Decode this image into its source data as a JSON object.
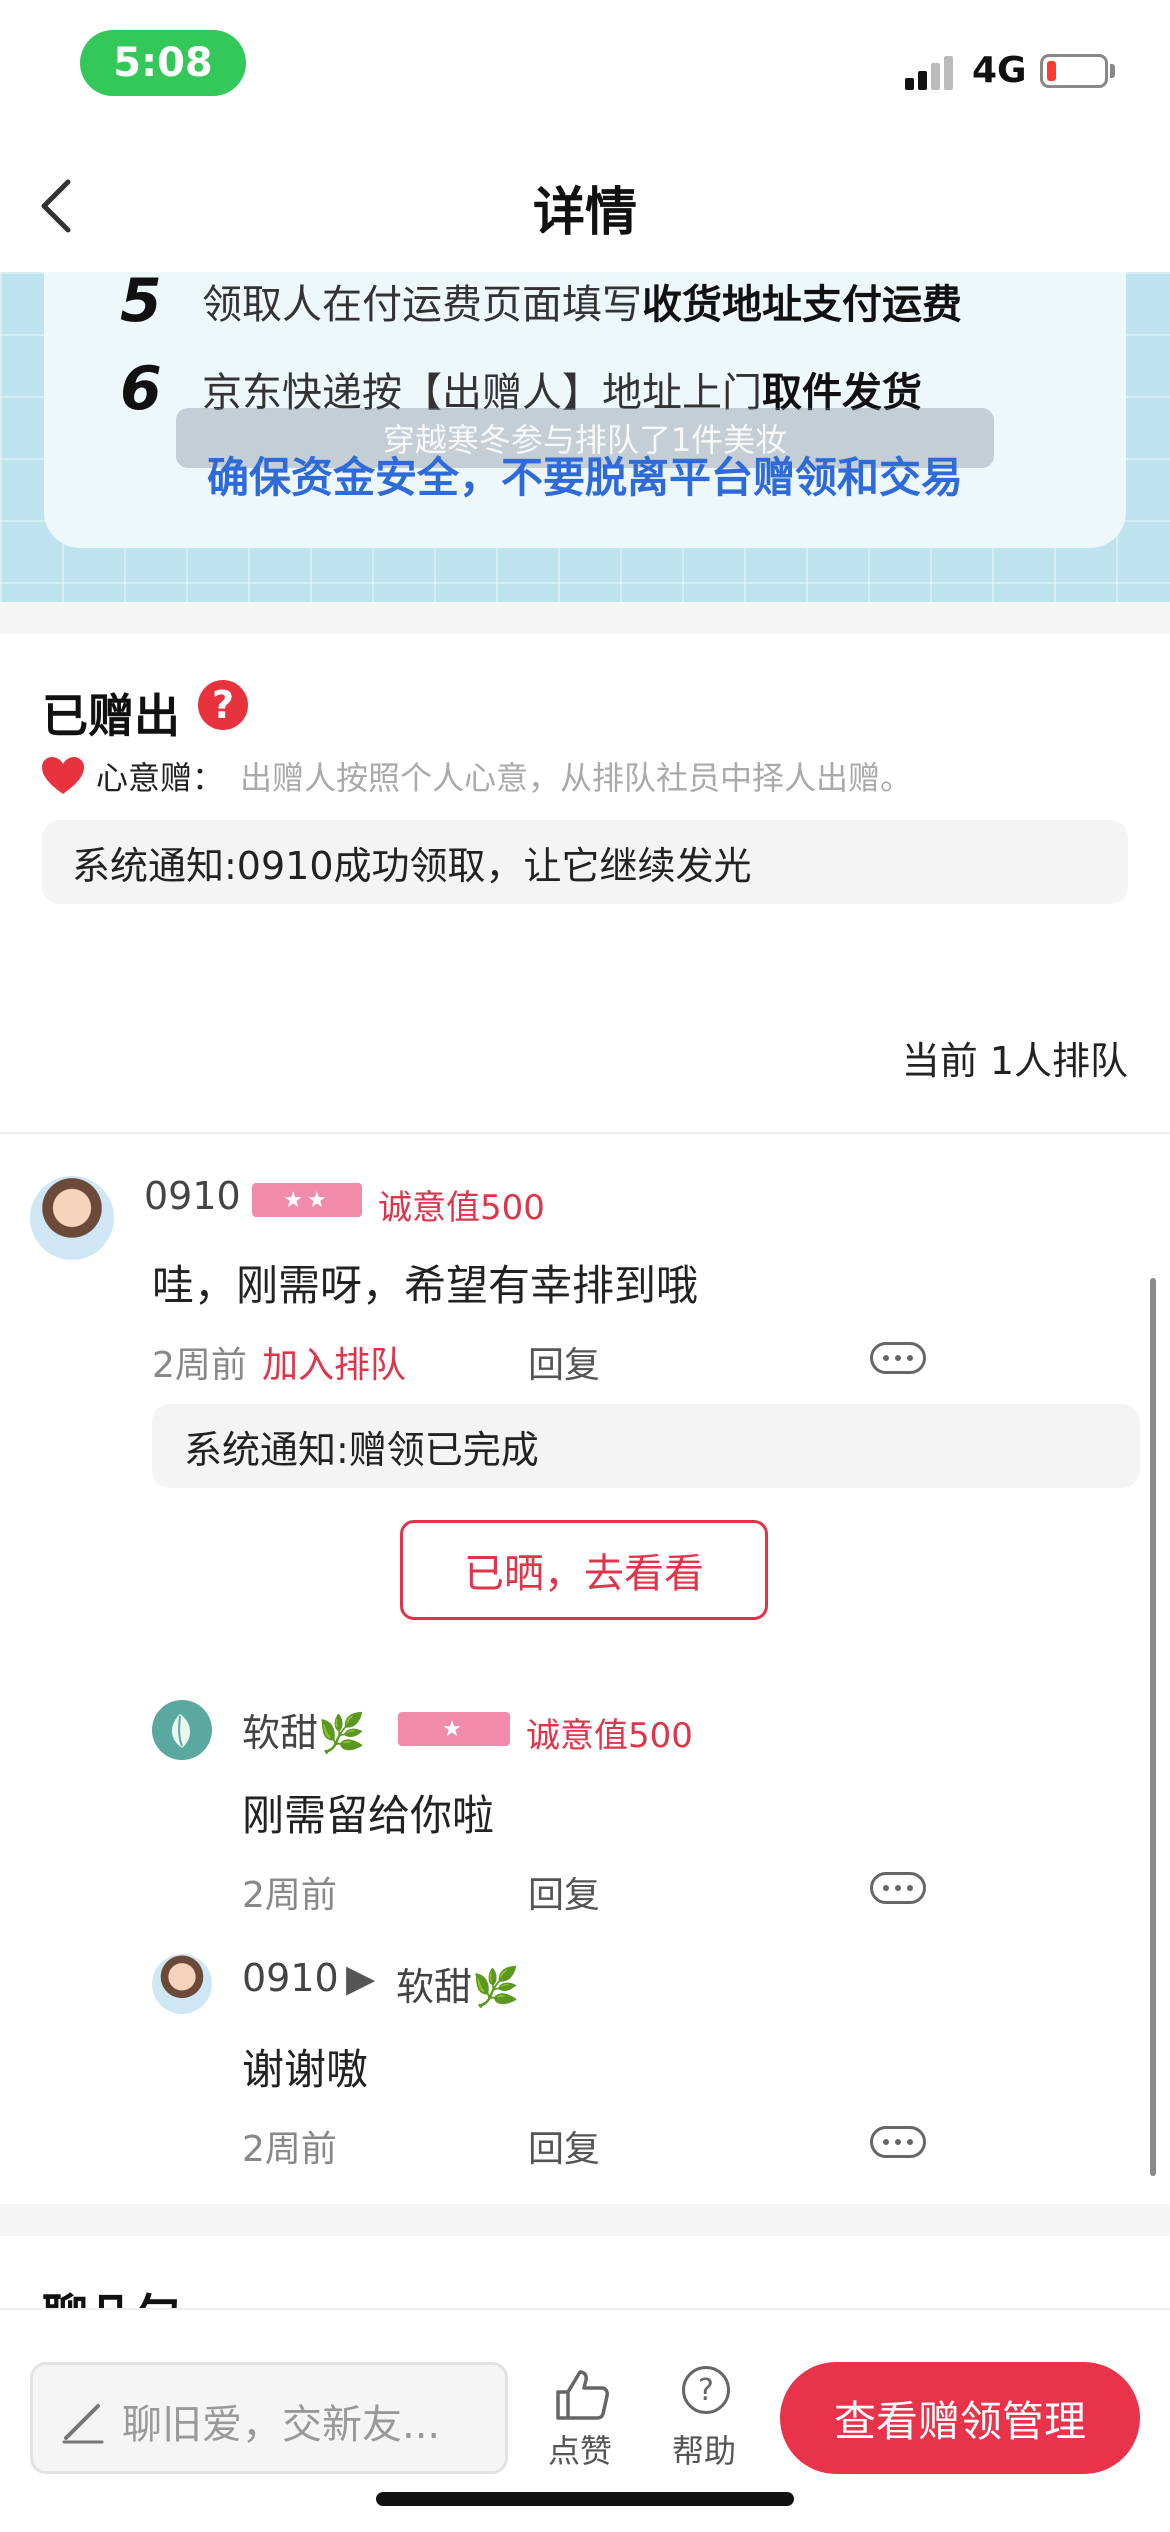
{
  "status_bar": {
    "time": "5:08",
    "network": "4G"
  },
  "nav": {
    "title": "详情"
  },
  "banner": {
    "steps": [
      {
        "num": "5",
        "text": "领取人在付运费页面填写",
        "bold": "收货地址支付运费"
      },
      {
        "num": "6",
        "text": "京东快递按【出赠人】地址上门",
        "bold": "取件发货"
      }
    ],
    "toast": "穿越寒冬参与排队了1件美妆",
    "warning": "确保资金安全，不要脱离平台赠领和交易"
  },
  "status": {
    "title": "已赠出",
    "help_symbol": "?",
    "mode_label": "心意赠：",
    "mode_desc": "出赠人按照个人心意，从排队社员中择人出赠。",
    "notice": "系统通知:0910成功领取，让它继续发光",
    "queue_count": "当前 1人排队"
  },
  "comments": {
    "main": {
      "username": "0910",
      "stars": "★★",
      "sincerity": "诚意值500",
      "text": "哇，刚需呀，希望有幸排到哦",
      "time": "2周前",
      "tag": "加入排队",
      "reply": "回复",
      "system_notice": "系统通知:赠领已完成",
      "view_button": "已晒，去看看"
    },
    "replies": [
      {
        "username": "软甜🌿",
        "stars": "★",
        "sincerity": "诚意值500",
        "text": "刚需留给你啦",
        "time": "2周前",
        "reply": "回复"
      },
      {
        "username": "0910",
        "arrow": "▶",
        "target": "软甜🌿",
        "text": "谢谢嗷",
        "time": "2周前",
        "reply": "回复"
      }
    ]
  },
  "next_section_title": "聊几句",
  "bottom_bar": {
    "input_placeholder": "聊旧爱，交新友...",
    "like_label": "点赞",
    "help_glyph": "?",
    "help_label": "帮助",
    "manage_button": "查看赠领管理"
  },
  "colors": {
    "accent": "#e8334a",
    "link_blue": "#2f6bd8",
    "status_green": "#34c759"
  }
}
